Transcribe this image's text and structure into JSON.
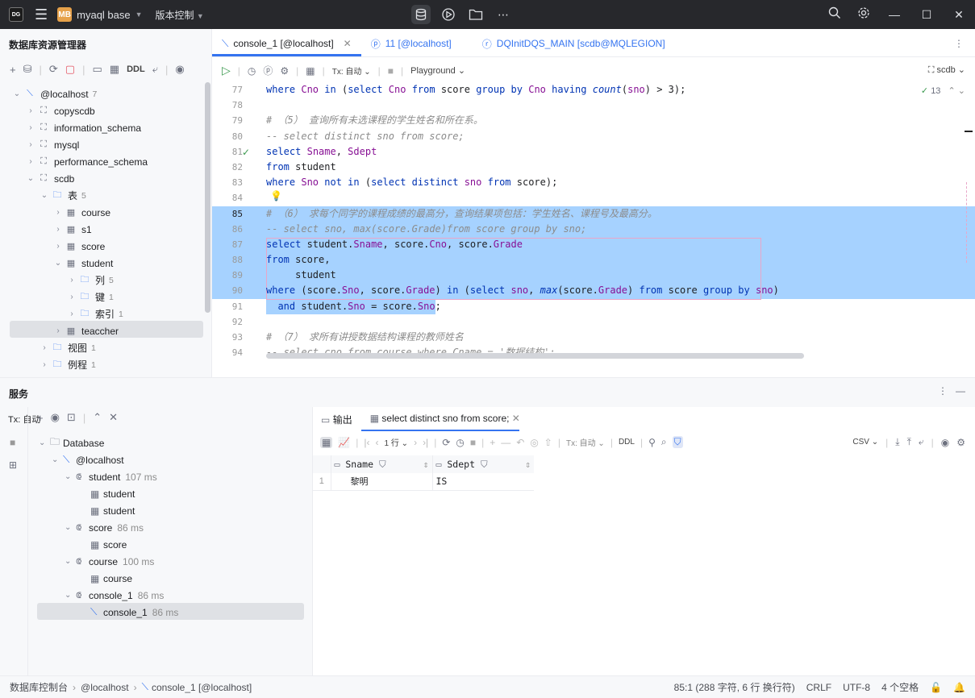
{
  "titlebar": {
    "logo": "DG",
    "menu_icon": "hamburger-icon",
    "project_badge": "MB",
    "project": "myaql base",
    "vcs": "版本控制"
  },
  "left": {
    "title": "数据库资源管理器",
    "ddl": "DDL"
  },
  "tree": [
    {
      "label": "@localhost",
      "count": "7",
      "depth": 0,
      "open": true,
      "icon": "host"
    },
    {
      "label": "copyscdb",
      "count": "",
      "depth": 1,
      "icon": "schema"
    },
    {
      "label": "information_schema",
      "count": "",
      "depth": 1,
      "icon": "schema"
    },
    {
      "label": "mysql",
      "count": "",
      "depth": 1,
      "icon": "schema"
    },
    {
      "label": "performance_schema",
      "count": "",
      "depth": 1,
      "icon": "schema"
    },
    {
      "label": "scdb",
      "count": "",
      "depth": 1,
      "open": true,
      "icon": "schema"
    },
    {
      "label": "表",
      "count": "5",
      "depth": 2,
      "open": true,
      "icon": "folder"
    },
    {
      "label": "course",
      "count": "",
      "depth": 3,
      "icon": "table"
    },
    {
      "label": "s1",
      "count": "",
      "depth": 3,
      "icon": "table"
    },
    {
      "label": "score",
      "count": "",
      "depth": 3,
      "icon": "table"
    },
    {
      "label": "student",
      "count": "",
      "depth": 3,
      "open": true,
      "icon": "table"
    },
    {
      "label": "列",
      "count": "5",
      "depth": 4,
      "icon": "folder"
    },
    {
      "label": "键",
      "count": "1",
      "depth": 4,
      "icon": "folder"
    },
    {
      "label": "索引",
      "count": "1",
      "depth": 4,
      "icon": "folder"
    },
    {
      "label": "teaccher",
      "count": "",
      "depth": 3,
      "icon": "table"
    },
    {
      "label": "视图",
      "count": "1",
      "depth": 2,
      "icon": "folder"
    },
    {
      "label": "例程",
      "count": "1",
      "depth": 2,
      "icon": "folder"
    }
  ],
  "editor": {
    "tabs": [
      {
        "label": "console_1 [@localhost]",
        "active": true
      },
      {
        "label": "11 [@localhost]",
        "active": false
      },
      {
        "label": "DQInitDQS_MAIN [scdb@MQLEGION]",
        "active": false
      }
    ],
    "tx": "Tx: 自动",
    "playground": "Playground",
    "schema": "scdb",
    "inspections": "13"
  },
  "code": [
    {
      "n": "77",
      "html": "<span class=\"kw\">where</span> <span class=\"id\">Cno</span> <span class=\"kw\">in</span> (<span class=\"kw\">select</span> <span class=\"id\">Cno</span> <span class=\"kw\">from</span> score <span class=\"kw\">group by</span> <span class=\"id\">Cno</span> <span class=\"kw\">having</span> <span class=\"fn\">count</span>(<span class=\"id\">sno</span>) &gt; 3);"
    },
    {
      "n": "78",
      "html": ""
    },
    {
      "n": "79",
      "html": "<span class=\"cm\"># （5） 查询所有未选课程的学生姓名和所在系。</span>"
    },
    {
      "n": "80",
      "html": "<span class=\"cm\">-- select distinct sno from score;</span>"
    },
    {
      "n": "81",
      "html": "<span class=\"kw\">select</span> <span class=\"id\">Sname</span>, <span class=\"id\">Sdept</span>"
    },
    {
      "n": "82",
      "html": "<span class=\"kw\">from</span> student"
    },
    {
      "n": "83",
      "html": "<span class=\"kw\">where</span> <span class=\"id\">Sno</span> <span class=\"kw\">not in</span> (<span class=\"kw\">select distinct</span> <span class=\"id\">sno</span> <span class=\"kw\">from</span> score);"
    },
    {
      "n": "84",
      "html": ""
    },
    {
      "n": "85",
      "html": "<span class=\"cm\"># （6） 求每个同学的课程成绩的最高分，查询结果项包括：学生姓名、课程号及最高分。</span>"
    },
    {
      "n": "86",
      "html": "<span class=\"cm\">-- select sno, max(score.Grade)from score group by sno;</span>"
    },
    {
      "n": "87",
      "html": "<span class=\"kw\">select</span> student.<span class=\"id\">Sname</span>, score.<span class=\"id\">Cno</span>, score.<span class=\"id\">Grade</span>"
    },
    {
      "n": "88",
      "html": "<span class=\"kw\">from</span> score,"
    },
    {
      "n": "89",
      "html": "     student"
    },
    {
      "n": "90",
      "html": "<span class=\"kw\">where</span> (score.<span class=\"id\">Sno</span>, score.<span class=\"id\">Grade</span>) <span class=\"kw\">in</span> (<span class=\"kw\">select</span> <span class=\"id\">sno</span>, <span class=\"fn\">max</span>(score.<span class=\"id\">Grade</span>) <span class=\"kw\">from</span> score <span class=\"kw\">group by</span> <span class=\"id\">sno</span>)"
    },
    {
      "n": "91",
      "html": "  <span class=\"kw\">and</span> student.<span class=\"id\">Sno</span> = score.<span class=\"id\">Sno</span>;"
    },
    {
      "n": "92",
      "html": ""
    },
    {
      "n": "93",
      "html": "<span class=\"cm\"># （7） 求所有讲授数据结构课程的教师姓名</span>"
    },
    {
      "n": "94",
      "html": "<span class=\"cm\">-- select cno from course where Cname = '数据结构';</span>"
    }
  ],
  "services": {
    "title": "服务",
    "tx": "Tx: 自动",
    "tree": [
      {
        "label": "Database",
        "time": "",
        "depth": 0,
        "icon": "folder"
      },
      {
        "label": "@localhost",
        "time": "",
        "depth": 1,
        "icon": "host"
      },
      {
        "label": "student",
        "time": "107 ms",
        "depth": 2,
        "icon": "session"
      },
      {
        "label": "student",
        "time": "",
        "depth": 3,
        "icon": "table"
      },
      {
        "label": "student",
        "time": "",
        "depth": 3,
        "icon": "table"
      },
      {
        "label": "score",
        "time": "86 ms",
        "depth": 2,
        "icon": "session"
      },
      {
        "label": "score",
        "time": "",
        "depth": 3,
        "icon": "table"
      },
      {
        "label": "course",
        "time": "100 ms",
        "depth": 2,
        "icon": "session"
      },
      {
        "label": "course",
        "time": "",
        "depth": 3,
        "icon": "table"
      },
      {
        "label": "console_1",
        "time": "86 ms",
        "depth": 2,
        "icon": "session"
      },
      {
        "label": "console_1",
        "time": "86 ms",
        "depth": 3,
        "icon": "console"
      }
    ],
    "tabs": [
      {
        "label": "输出"
      },
      {
        "label": "select distinct sno from score;"
      }
    ],
    "rows_label": "1 行",
    "ddl": "DDL",
    "csv": "CSV",
    "columns": [
      "Sname",
      "Sdept"
    ],
    "rows": [
      [
        "1",
        "黎明",
        "IS"
      ]
    ]
  },
  "status": {
    "crumbs": [
      "数据库控制台",
      "@localhost",
      "console_1 [@localhost]"
    ],
    "position": "85:1 (288 字符, 6 行 换行符)",
    "eol": "CRLF",
    "encoding": "UTF-8",
    "indent": "4 个空格"
  }
}
